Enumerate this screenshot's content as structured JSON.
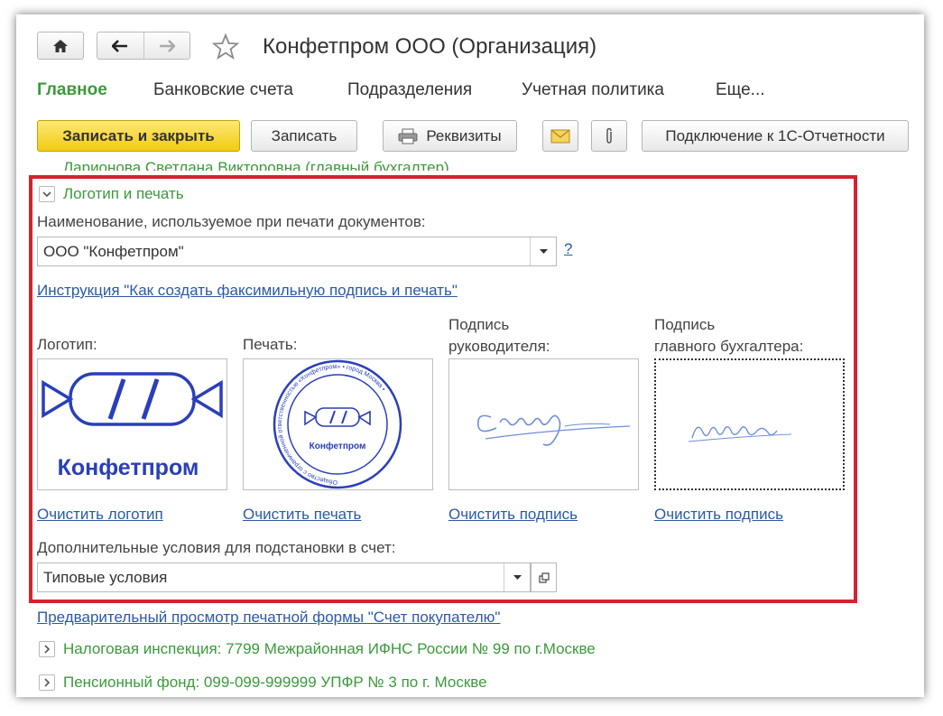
{
  "window": {
    "title": "Конфетпром ООО (Организация)"
  },
  "nav": {
    "home_icon": "home-icon",
    "back_icon": "arrow-left-icon",
    "forward_icon": "arrow-right-icon",
    "favorite_icon": "star-icon"
  },
  "tabs": [
    {
      "label": "Главное",
      "active": true
    },
    {
      "label": "Банковские счета"
    },
    {
      "label": "Подразделения"
    },
    {
      "label": "Учетная политика"
    },
    {
      "label": "Еще..."
    }
  ],
  "toolbar": {
    "save_close": "Записать и закрыть",
    "save": "Записать",
    "requisites": "Реквизиты",
    "connect": "Подключение к 1С-Отчетности"
  },
  "cut_text": "Ларионова Светлана Викторовна (главный бухгалтер)",
  "logo_section": {
    "title": "Логотип и печать",
    "name_label": "Наименование, используемое при печати документов:",
    "name_value": "ООО \"Конфетпром\"",
    "help": "?",
    "instruction_link": "Инструкция \"Как создать факсимильную подпись и печать\"",
    "logo_label": "Логотип:",
    "stamp_label": "Печать:",
    "director_label_1": "Подпись",
    "director_label_2": "руководителя:",
    "accountant_label_1": "Подпись",
    "accountant_label_2": "главного бухгалтера:",
    "logo_text": "Конфетпром",
    "stamp_text": "Конфетпром",
    "stamp_ring": "Общество с ограниченной ответственностью «Конфетпром» • город Москва •",
    "clear_logo": "Очистить логотип",
    "clear_stamp": "Очистить печать",
    "clear_sign1": "Очистить подпись",
    "clear_sign2": "Очистить подпись",
    "conditions_label": "Дополнительные условия для подстановки в счет:",
    "conditions_value": "Типовые условия"
  },
  "preview_link": "Предварительный просмотр печатной формы \"Счет покупателю\"",
  "sections": [
    {
      "label": "Налоговая инспекция: 7799 Межрайонная ИФНС России № 99 по г.Москве"
    },
    {
      "label": "Пенсионный фонд: 099-099-999999 УПФР № 3 по г. Москве"
    }
  ],
  "colors": {
    "accent_green": "#3b9a3b",
    "link_blue": "#2a5aa6",
    "highlight_red": "#d4232e",
    "primary_yellow": "#f1cb13",
    "logo_blue": "#2a3fb8"
  }
}
